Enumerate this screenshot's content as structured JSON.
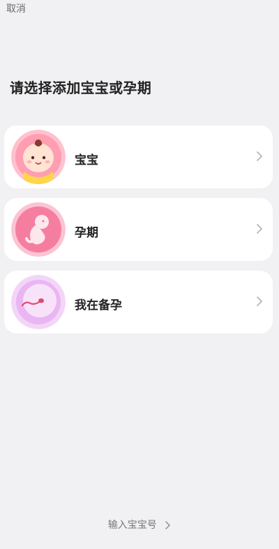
{
  "header": {
    "cancel_label": "取消",
    "title": "请选择添加宝宝或孕期"
  },
  "options": [
    {
      "label": "宝宝",
      "icon": "baby-face-icon"
    },
    {
      "label": "孕期",
      "icon": "fetus-icon"
    },
    {
      "label": "我在备孕",
      "icon": "sperm-egg-icon"
    }
  ],
  "footer": {
    "link_label": "输入宝宝号"
  },
  "colors": {
    "background": "#f1f1f3",
    "card": "#ffffff",
    "baby_bg": "#ff9db2",
    "pregnancy_bg": "#f57ea0",
    "prep_bg": "#e9b6f2"
  }
}
